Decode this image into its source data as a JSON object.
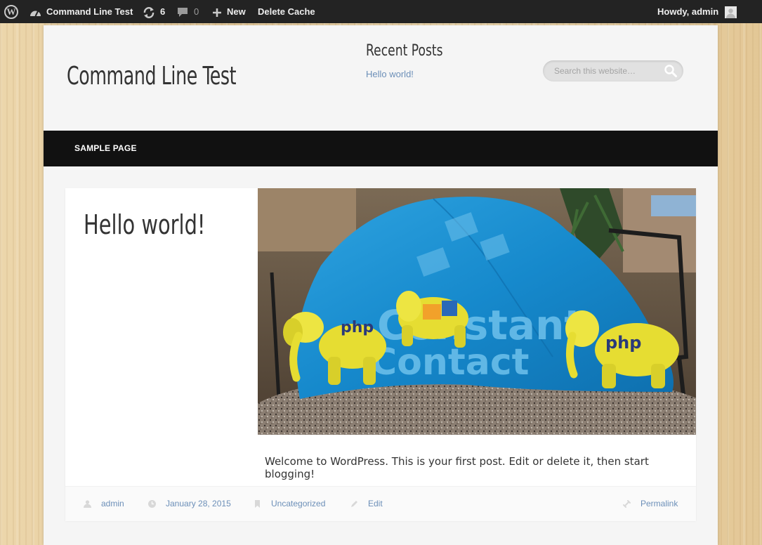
{
  "admin_bar": {
    "site_name": "Command Line Test",
    "updates_count": "6",
    "comments_count": "0",
    "new_label": "New",
    "delete_cache_label": "Delete Cache",
    "howdy_label": "Howdy, admin"
  },
  "header": {
    "site_title": "Command Line Test",
    "recent_posts_title": "Recent Posts",
    "recent_posts": [
      "Hello world!"
    ],
    "search_placeholder": "Search this website…"
  },
  "nav": {
    "items": [
      "SAMPLE PAGE"
    ]
  },
  "post": {
    "title": "Hello world!",
    "content": "Welcome to WordPress. This is your first post. Edit or delete it, then start blogging!",
    "meta": {
      "author": "admin",
      "date": "January 28, 2015",
      "category": "Uncategorized",
      "edit": "Edit",
      "permalink": "Permalink"
    },
    "image_lettering": [
      "php",
      "php",
      "Constant Contact"
    ]
  },
  "colors": {
    "admin_bar": "#232323",
    "nav_bar": "#111111",
    "link": "#6c8fb8",
    "page_bg": "#f5f5f5",
    "towel_blue": "#1a8fd0",
    "elephant_yellow": "#e9e23a"
  },
  "icons": [
    "wordpress-logo-icon",
    "dashboard-icon",
    "updates-icon",
    "comment-icon",
    "plus-icon",
    "avatar-icon",
    "search-icon",
    "user-icon",
    "clock-icon",
    "bookmark-icon",
    "pencil-icon",
    "link-icon"
  ]
}
